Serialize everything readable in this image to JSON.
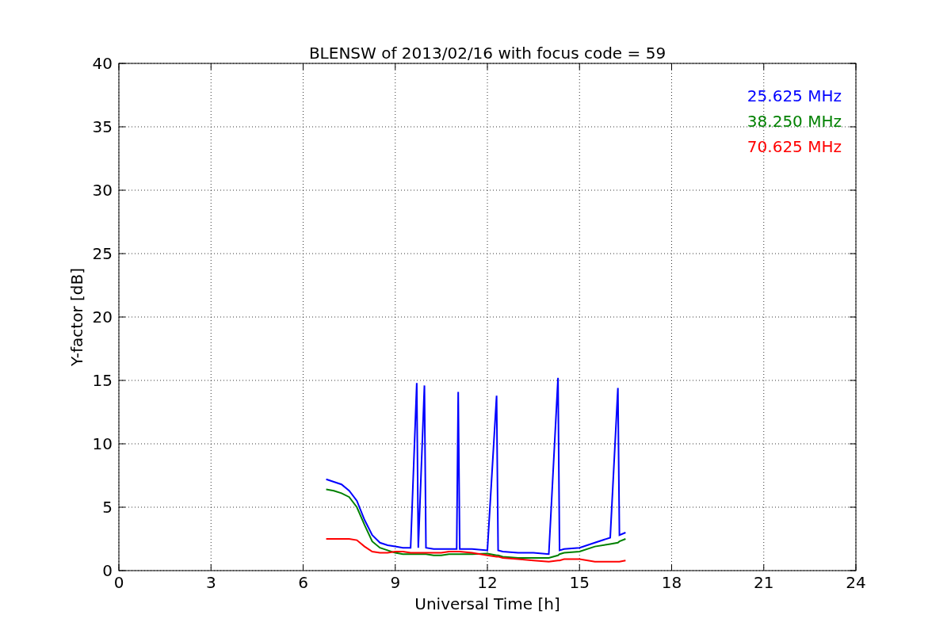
{
  "chart_data": {
    "type": "line",
    "title": "BLENSW of 2013/02/16 with focus code = 59",
    "xlabel": "Universal Time [h]",
    "ylabel": "Y-factor [dB]",
    "x": [
      6.75,
      7,
      7.25,
      7.5,
      7.75,
      8,
      8.25,
      8.5,
      8.75,
      9,
      9.25,
      9.5,
      9.7,
      9.75,
      9.95,
      10,
      10.25,
      10.5,
      10.75,
      11,
      11.05,
      11.1,
      11.5,
      12,
      12.3,
      12.35,
      12.5,
      13,
      13.5,
      14,
      14.3,
      14.35,
      14.5,
      15,
      15.5,
      16,
      16.25,
      16.3,
      16.5
    ],
    "series": [
      {
        "name": "25.625 MHz",
        "color": "#0000ff",
        "values": [
          7.2,
          7.0,
          6.8,
          6.3,
          5.5,
          4.0,
          2.8,
          2.2,
          2.0,
          1.9,
          1.8,
          1.8,
          14.8,
          1.8,
          14.6,
          1.8,
          1.7,
          1.7,
          1.7,
          1.7,
          14.1,
          1.7,
          1.7,
          1.6,
          13.8,
          1.6,
          1.5,
          1.4,
          1.4,
          1.3,
          15.2,
          1.6,
          1.7,
          1.8,
          2.2,
          2.6,
          14.4,
          2.8,
          3.0
        ]
      },
      {
        "name": "38.250 MHz",
        "color": "#008000",
        "values": [
          6.4,
          6.3,
          6.1,
          5.8,
          5.0,
          3.6,
          2.3,
          1.8,
          1.6,
          1.4,
          1.3,
          1.3,
          1.3,
          1.3,
          1.3,
          1.3,
          1.2,
          1.2,
          1.3,
          1.3,
          1.3,
          1.3,
          1.3,
          1.35,
          1.2,
          1.2,
          1.1,
          1.0,
          1.0,
          1.0,
          1.2,
          1.3,
          1.4,
          1.5,
          1.9,
          2.1,
          2.2,
          2.3,
          2.5
        ]
      },
      {
        "name": "70.625 MHz",
        "color": "#ff0000",
        "values": [
          2.5,
          2.5,
          2.5,
          2.5,
          2.4,
          1.9,
          1.5,
          1.4,
          1.4,
          1.5,
          1.5,
          1.4,
          1.4,
          1.4,
          1.4,
          1.4,
          1.4,
          1.4,
          1.5,
          1.5,
          1.5,
          1.5,
          1.4,
          1.2,
          1.1,
          1.1,
          1.0,
          0.9,
          0.8,
          0.7,
          0.8,
          0.8,
          0.9,
          0.9,
          0.7,
          0.7,
          0.7,
          0.7,
          0.8
        ]
      }
    ],
    "grid": true,
    "xlim": [
      0,
      24
    ],
    "ylim": [
      0,
      40
    ],
    "xticks": [
      0,
      3,
      6,
      9,
      12,
      15,
      18,
      21,
      24
    ],
    "yticks": [
      0,
      5,
      10,
      15,
      20,
      25,
      30,
      35,
      40
    ]
  }
}
